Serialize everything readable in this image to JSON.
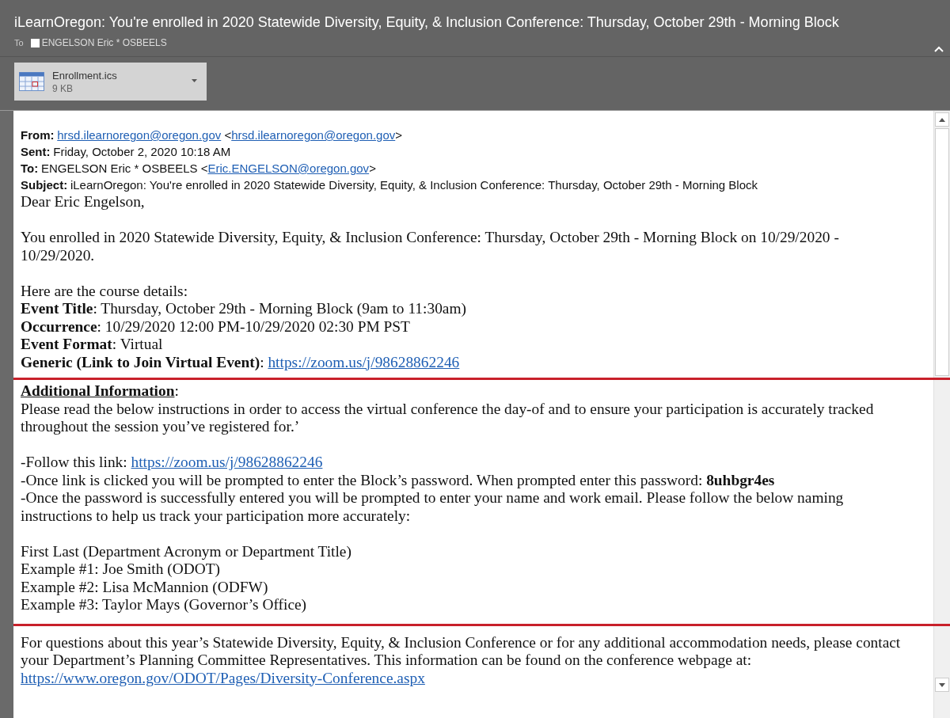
{
  "window": {
    "title": "iLearnOregon: You're enrolled in 2020 Statewide Diversity, Equity, & Inclusion Conference: Thursday, October 29th - Morning Block",
    "to_label": "To",
    "recipient": "ENGELSON Eric * OSBEELS"
  },
  "attachment": {
    "name": "Enrollment.ics",
    "size": "9 KB"
  },
  "body": {
    "bands": [
      {
        "highlighted": false,
        "blocks": [
          {
            "kind": "header",
            "lines": [
              [
                {
                  "kind": "label",
                  "text": "From:"
                },
                {
                  "kind": "link",
                  "text": "hrsd.ilearnoregon@oregon.gov"
                },
                {
                  "kind": "text",
                  "text": " <"
                },
                {
                  "kind": "link",
                  "text": "hrsd.ilearnoregon@oregon.gov"
                },
                {
                  "kind": "text",
                  "text": ">"
                }
              ],
              [
                {
                  "kind": "label",
                  "text": "Sent:"
                },
                {
                  "kind": "text",
                  "text": "Friday, October 2, 2020 10:18 AM"
                }
              ],
              [
                {
                  "kind": "label",
                  "text": "To:"
                },
                {
                  "kind": "text",
                  "text": "ENGELSON Eric * OSBEELS <"
                },
                {
                  "kind": "link",
                  "text": "Eric.ENGELSON@oregon.gov"
                },
                {
                  "kind": "text",
                  "text": ">"
                }
              ],
              [
                {
                  "kind": "label",
                  "text": "Subject:"
                },
                {
                  "kind": "text",
                  "text": "iLearnOregon: You're enrolled in 2020 Statewide Diversity, Equity, & Inclusion Conference: Thursday, October 29th - Morning Block"
                }
              ]
            ]
          },
          {
            "kind": "body",
            "lines": [
              [
                {
                  "kind": "text",
                  "text": "Dear Eric Engelson,"
                }
              ]
            ]
          },
          {
            "kind": "body",
            "lines": [
              [
                {
                  "kind": "text",
                  "text": "You enrolled in 2020 Statewide Diversity, Equity, & Inclusion Conference: Thursday, October 29th - Morning Block on 10/29/2020 - 10/29/2020."
                }
              ]
            ]
          },
          {
            "kind": "body",
            "lines": [
              [
                {
                  "kind": "text",
                  "text": "Here are the course details:"
                }
              ],
              [
                {
                  "kind": "text",
                  "text": "**Event Title**: Thursday, October 29th - Morning Block (9am to 11:30am)"
                }
              ],
              [
                {
                  "kind": "text",
                  "text": "**Occurrence**: 10/29/2020 12:00 PM-10/29/2020 02:30 PM PST"
                }
              ],
              [
                {
                  "kind": "text",
                  "text": "**Event Format**: Virtual"
                }
              ],
              [
                {
                  "kind": "text",
                  "text": "**Generic (Link to Join Virtual Event)**: "
                },
                {
                  "kind": "link",
                  "text": "https://zoom.us/j/98628862246"
                }
              ]
            ]
          }
        ]
      },
      {
        "highlighted": true,
        "blocks": [
          {
            "kind": "body",
            "lines": [
              [
                {
                  "kind": "heading",
                  "text": "Additional Information"
                },
                {
                  "kind": "text",
                  "text": ":"
                }
              ],
              [
                {
                  "kind": "text",
                  "text": "Please read the below instructions in order to access the virtual conference the day-of and to ensure your participation is accurately tracked throughout the session you’ve registered for.’"
                }
              ]
            ]
          },
          {
            "kind": "body",
            "lines": [
              [
                {
                  "kind": "text",
                  "text": "-Follow this link: "
                },
                {
                  "kind": "link",
                  "text": "https://zoom.us/j/98628862246"
                }
              ],
              [
                {
                  "kind": "text",
                  "text": "-Once link is clicked you will be prompted to enter the Block’s password. When prompted enter this password: **8uhbgr4es**"
                }
              ],
              [
                {
                  "kind": "text",
                  "text": "-Once the password is successfully entered you will be prompted to enter your name and work email. Please follow the below naming instructions to help us track your participation more accurately:"
                }
              ]
            ]
          },
          {
            "kind": "body",
            "lines": [
              [
                {
                  "kind": "text",
                  "text": "First Last (Department Acronym or Department Title)"
                }
              ],
              [
                {
                  "kind": "text",
                  "text": "Example #1: Joe Smith (ODOT)"
                }
              ],
              [
                {
                  "kind": "text",
                  "text": "Example #2: Lisa McMannion (ODFW)"
                }
              ],
              [
                {
                  "kind": "text",
                  "text": "Example #3: Taylor Mays (Governor’s Office)"
                }
              ]
            ]
          }
        ]
      },
      {
        "highlighted": false,
        "blocks": [
          {
            "kind": "body",
            "lines": [
              [
                {
                  "kind": "text",
                  "text": "For questions about this year’s Statewide Diversity, Equity, & Inclusion Conference or for any additional accommodation needs, please contact your Department’s Planning Committee Representatives. This information can be found on the conference webpage at: "
                },
                {
                  "kind": "link",
                  "text": "https://www.oregon.gov/ODOT/Pages/Diversity-Conference.aspx"
                }
              ]
            ]
          }
        ]
      }
    ]
  }
}
